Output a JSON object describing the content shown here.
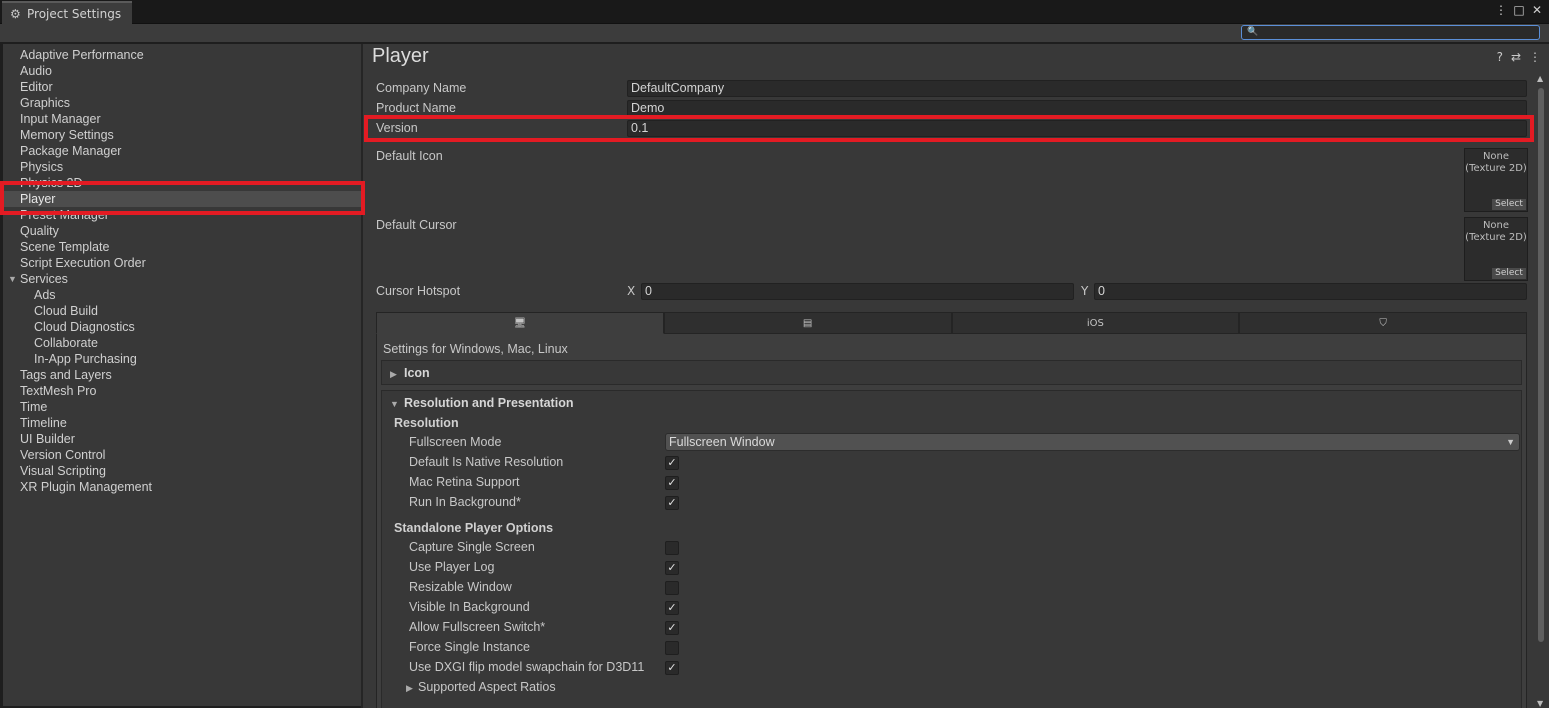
{
  "window": {
    "title": "Project Settings",
    "controls": [
      "⋮",
      "□",
      "✕"
    ]
  },
  "search": {
    "placeholder": ""
  },
  "sidebar": {
    "items": [
      {
        "label": "Adaptive Performance"
      },
      {
        "label": "Audio"
      },
      {
        "label": "Editor"
      },
      {
        "label": "Graphics"
      },
      {
        "label": "Input Manager"
      },
      {
        "label": "Memory Settings"
      },
      {
        "label": "Package Manager"
      },
      {
        "label": "Physics"
      },
      {
        "label": "Physics 2D"
      },
      {
        "label": "Player"
      },
      {
        "label": "Preset Manager"
      },
      {
        "label": "Quality"
      },
      {
        "label": "Scene Template"
      },
      {
        "label": "Script Execution Order"
      },
      {
        "label": "Services"
      },
      {
        "label": "Ads"
      },
      {
        "label": "Cloud Build"
      },
      {
        "label": "Cloud Diagnostics"
      },
      {
        "label": "Collaborate"
      },
      {
        "label": "In-App Purchasing"
      },
      {
        "label": "Tags and Layers"
      },
      {
        "label": "TextMesh Pro"
      },
      {
        "label": "Time"
      },
      {
        "label": "Timeline"
      },
      {
        "label": "UI Builder"
      },
      {
        "label": "Version Control"
      },
      {
        "label": "Visual Scripting"
      },
      {
        "label": "XR Plugin Management"
      }
    ],
    "selected": "Player"
  },
  "main": {
    "title": "Player",
    "header_icons": [
      "?",
      "⇄",
      "⋮"
    ],
    "company_name_label": "Company Name",
    "company_name_value": "DefaultCompany",
    "product_name_label": "Product Name",
    "product_name_value": "Demo",
    "version_label": "Version",
    "version_value": "0.1",
    "default_icon_label": "Default Icon",
    "default_cursor_label": "Default Cursor",
    "texture_none": "None",
    "texture_type": "(Texture 2D)",
    "texture_select": "Select",
    "cursor_hotspot_label": "Cursor Hotspot",
    "hotspot_x_label": "X",
    "hotspot_x_value": "0",
    "hotspot_y_label": "Y",
    "hotspot_y_value": "0"
  },
  "platform_tabs": [
    {
      "icon": "desktop-icon",
      "label": "🖥"
    },
    {
      "icon": "server-icon",
      "label": "▤"
    },
    {
      "icon": "ios-text",
      "label": "iOS"
    },
    {
      "icon": "html5-icon",
      "label": "⛉"
    }
  ],
  "settings_for": "Settings for Windows, Mac, Linux",
  "icon_section": "Icon",
  "resolution_section": "Resolution and Presentation",
  "resolution_sub": "Resolution",
  "fullscreen_mode_label": "Fullscreen Mode",
  "fullscreen_mode_value": "Fullscreen Window",
  "resolution_options": [
    {
      "label": "Default Is Native Resolution",
      "checked": true
    },
    {
      "label": "Mac Retina Support",
      "checked": true
    },
    {
      "label": "Run In Background*",
      "checked": true
    }
  ],
  "standalone_sub": "Standalone Player Options",
  "standalone_options": [
    {
      "label": "Capture Single Screen",
      "checked": false
    },
    {
      "label": "Use Player Log",
      "checked": true
    },
    {
      "label": "Resizable Window",
      "checked": false
    },
    {
      "label": "Visible In Background",
      "checked": true
    },
    {
      "label": "Allow Fullscreen Switch*",
      "checked": true
    },
    {
      "label": "Force Single Instance",
      "checked": false
    },
    {
      "label": "Use DXGI flip model swapchain for D3D11",
      "checked": true
    }
  ],
  "supported_aspect_ratios": "Supported Aspect Ratios",
  "check_glyph": "✓",
  "colors": {
    "highlight": "#e31b23",
    "background": "#383838",
    "field": "#2a2a2a"
  }
}
